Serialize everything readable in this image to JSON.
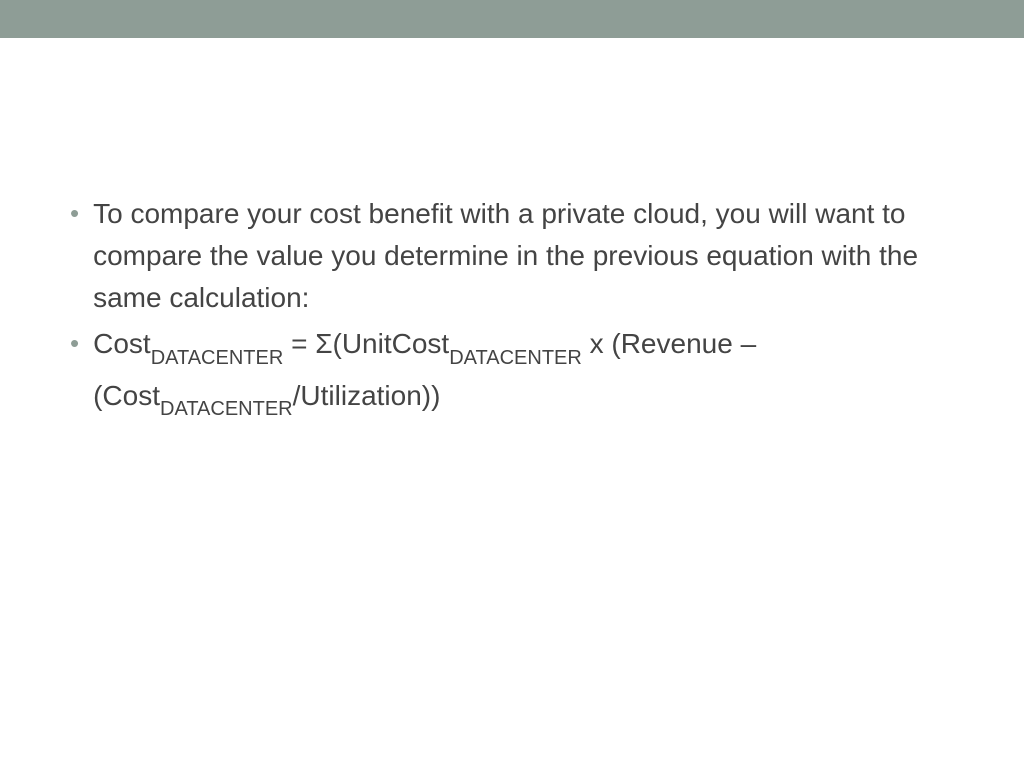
{
  "bullets": {
    "item1": "To compare your cost benefit with a private cloud, you will want to compare the value you determine in the previous equation with the same calculation:",
    "item2": {
      "p1": "Cost",
      "sub1": "DATACENTER",
      "p2": " = Σ(UnitCost",
      "sub2": "DATACENTER",
      "p3": " x (Revenue – (Cost",
      "sub3": "DATACENTER",
      "p4": "/Utilization))"
    }
  }
}
